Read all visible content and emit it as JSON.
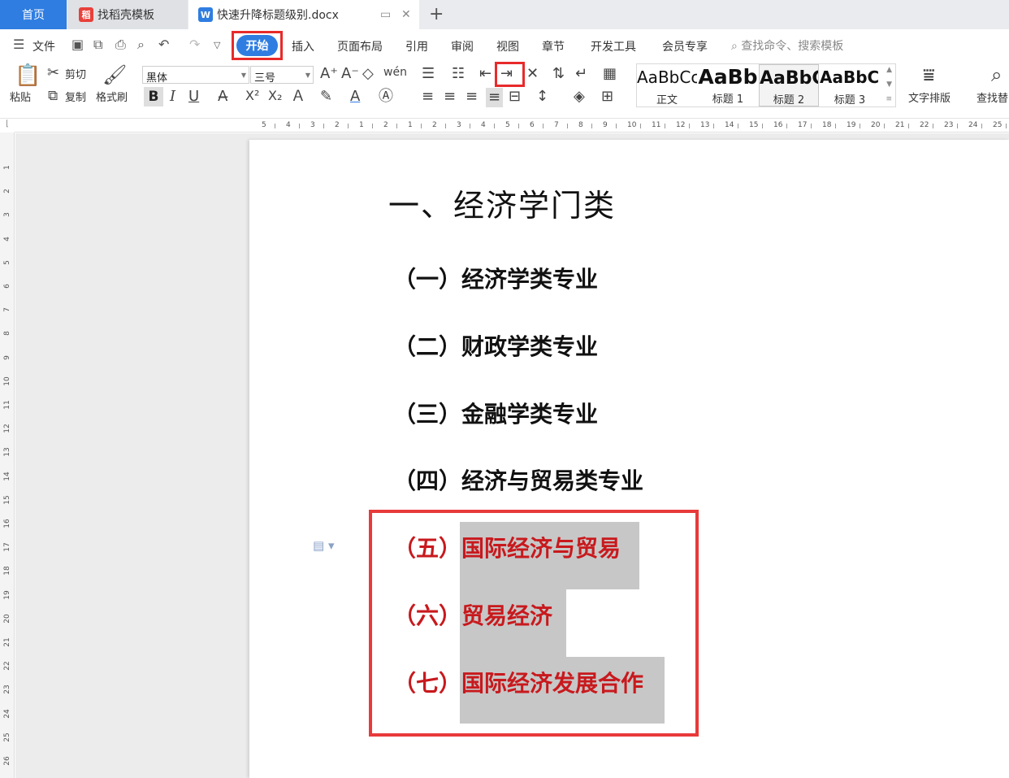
{
  "tabs": {
    "home": "首页",
    "templates": "找稻壳模板",
    "document": "快速升降标题级别.docx"
  },
  "menu": {
    "file": "文件",
    "items": [
      "开始",
      "插入",
      "页面布局",
      "引用",
      "审阅",
      "视图",
      "章节",
      "开发工具",
      "会员专享"
    ],
    "search_placeholder": "查找命令、搜索模板"
  },
  "ribbon": {
    "paste": "粘贴",
    "cut": "剪切",
    "copy": "复制",
    "format_painter": "格式刷",
    "font_name": "黑体",
    "font_size": "三号",
    "styles": [
      {
        "sample": "AaBbCcDd",
        "name": "正文"
      },
      {
        "sample": "AaBb",
        "name": "标题 1"
      },
      {
        "sample": "AaBbC",
        "name": "标题 2"
      },
      {
        "sample": "AaBbCc",
        "name": "标题 3"
      }
    ],
    "text_layout": "文字排版",
    "find_replace": "查找替"
  },
  "ruler": {
    "horizontal_labels": [
      "5",
      "4",
      "3",
      "2",
      "1",
      "2",
      "1",
      "2",
      "3",
      "4",
      "5",
      "6",
      "7",
      "8",
      "9",
      "10",
      "11",
      "12",
      "13",
      "14",
      "15",
      "16",
      "17",
      "18",
      "19",
      "20",
      "21",
      "22",
      "23",
      "24",
      "25"
    ],
    "vertical_labels": [
      "1",
      "2",
      "3",
      "4",
      "5",
      "6",
      "7",
      "8",
      "9",
      "10",
      "11",
      "12",
      "13",
      "14",
      "15",
      "16",
      "17",
      "18",
      "19",
      "20",
      "21",
      "22",
      "23",
      "24",
      "25",
      "26"
    ]
  },
  "document": {
    "heading1": "一、经济学门类",
    "headings2": [
      {
        "prefix": "（一）",
        "text": "经济学类专业"
      },
      {
        "prefix": "（二）",
        "text": "财政学类专业"
      },
      {
        "prefix": "（三）",
        "text": "金融学类专业"
      },
      {
        "prefix": "（四）",
        "text": "经济与贸易类专业"
      },
      {
        "prefix": "（五）",
        "text": "国际经济与贸易"
      },
      {
        "prefix": "（六）",
        "text": "贸易经济"
      },
      {
        "prefix": "（七）",
        "text": "国际经济发展合作"
      }
    ]
  },
  "colors": {
    "accent_blue": "#2f7de1",
    "highlight_red": "#e82a2a",
    "heading_red": "#c8191d",
    "selection_gray": "#c7c7c7"
  }
}
